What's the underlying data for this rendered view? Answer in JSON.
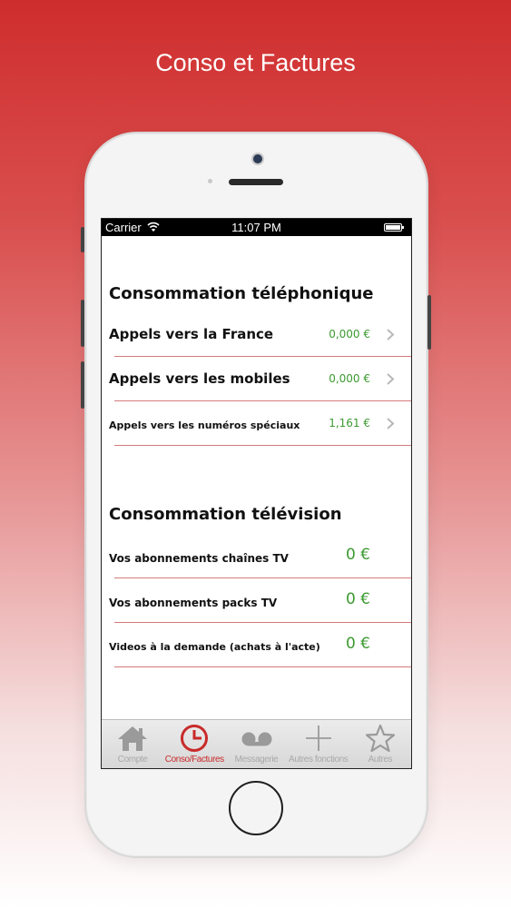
{
  "promo_title": "Conso et Factures",
  "status_bar": {
    "carrier": "Carrier",
    "time": "11:07 PM"
  },
  "telephone": {
    "title": "Consommation téléphonique",
    "rows": [
      {
        "label": "Appels vers la France",
        "value": "0,000 €"
      },
      {
        "label": "Appels vers les mobiles",
        "value": "0,000 €"
      },
      {
        "label": "Appels vers les numéros spéciaux",
        "value": "1,161 €"
      }
    ]
  },
  "television": {
    "title": "Consommation télévision",
    "rows": [
      {
        "label": "Vos abonnements chaînes TV",
        "value": "0 €"
      },
      {
        "label": "Vos abonnements packs TV",
        "value": "0 €"
      },
      {
        "label": "Videos à la demande (achats à l'acte)",
        "value": "0 €"
      }
    ]
  },
  "tab_bar": {
    "active_color": "#c92a2a",
    "inactive_color": "#a9a9a9",
    "tabs": [
      {
        "label": "Compte",
        "icon": "home-icon"
      },
      {
        "label": "Conso/Factures",
        "icon": "clock-icon"
      },
      {
        "label": "Messagerie",
        "icon": "voicemail-icon"
      },
      {
        "label": "Autres fonctions",
        "icon": "plus-icon"
      },
      {
        "label": "Autres",
        "icon": "star-icon"
      }
    ]
  },
  "value_color": "#3c9a30",
  "divider_color": "#d47a7a"
}
